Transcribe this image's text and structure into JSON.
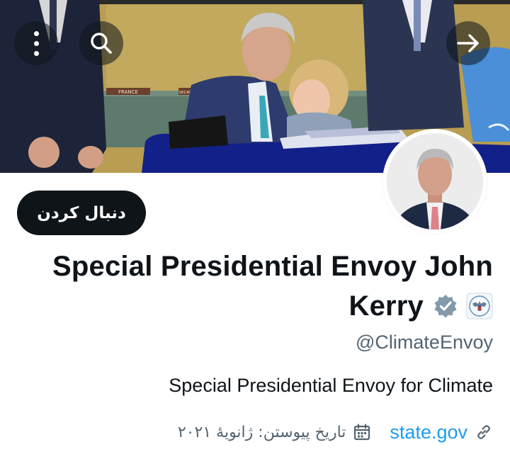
{
  "banner": {
    "more_icon": "more-vertical-icon",
    "search_icon": "search-icon",
    "forward_icon": "arrow-right-icon",
    "placard_left": "FRANCE",
    "placard_right": "SECRETARY-GE"
  },
  "profile": {
    "follow_label": "دنبال کردن",
    "name_line1": "Special Presidential Envoy John",
    "name_line2": "Kerry",
    "verified_icon": "verified-badge-icon",
    "affiliation_icon": "us-government-seal-icon",
    "handle": "@ClimateEnvoy",
    "bio": "Special Presidential Envoy for Climate",
    "website": "state.gov",
    "website_icon": "link-icon",
    "joined": "تاریخ پیوستن: ژانویهٔ ۲۰۲۱",
    "joined_icon": "calendar-icon"
  },
  "colors": {
    "follow_bg": "#0f1419",
    "link": "#1d9bf0",
    "secondary_text": "#536471",
    "verified_gray": "#829aab"
  }
}
